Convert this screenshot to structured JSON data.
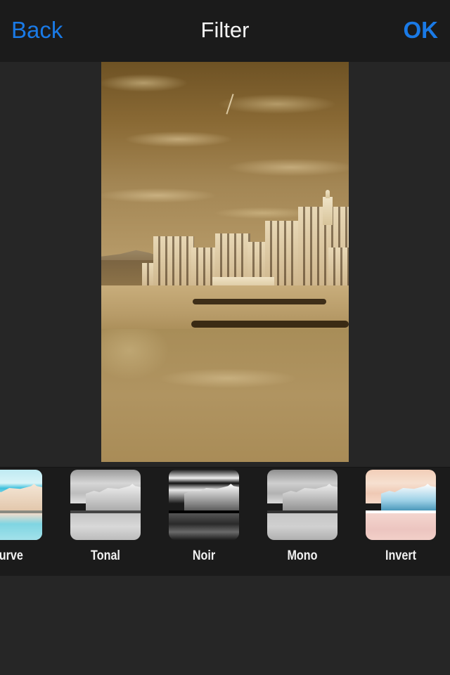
{
  "navbar": {
    "back_label": "Back",
    "title": "Filter",
    "ok_label": "OK",
    "accent_color": "#1a7ae6"
  },
  "preview": {
    "description": "Sepia-toned photo of a coastal Italian town with cloudy sky, beach and sea",
    "applied_tone": "sepia"
  },
  "filters": [
    {
      "label": "Curve",
      "style": "curve"
    },
    {
      "label": "Tonal",
      "style": "tonal"
    },
    {
      "label": "Noir",
      "style": "noir"
    },
    {
      "label": "Mono",
      "style": "mono"
    },
    {
      "label": "Invert",
      "style": "invert"
    }
  ]
}
